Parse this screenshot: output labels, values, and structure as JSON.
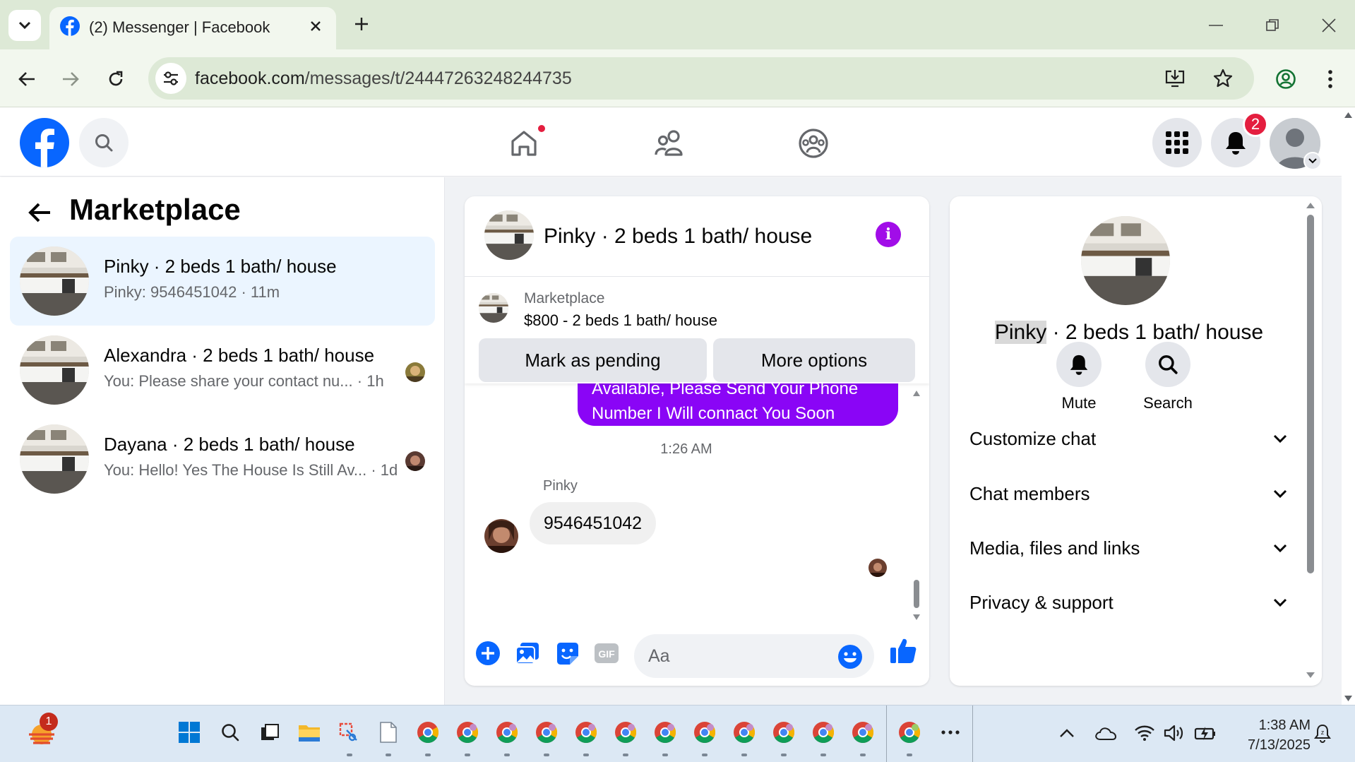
{
  "browser": {
    "tab_title": "(2) Messenger | Facebook",
    "url_host": "facebook.com",
    "url_path": "/messages/t/24447263248244735"
  },
  "fb_header": {
    "notification_count": "2",
    "icons": [
      "facebook-logo",
      "search-icon",
      "home-icon",
      "friends-icon",
      "groups-icon",
      "menu-grid-icon",
      "bell-icon",
      "account-avatar"
    ]
  },
  "sidebar": {
    "title": "Marketplace",
    "conversations": [
      {
        "name": "Pinky · 2 beds 1 bath/ house",
        "preview": "Pinky: 9546451042 · 11m"
      },
      {
        "name": "Alexandra · 2 beds 1 bath/ house",
        "preview": "You: Please share your contact nu...",
        "time": "· 1h"
      },
      {
        "name": "Dayana · 2 beds 1 bath/ house",
        "preview": "You: Hello! Yes The House Is Still Av...",
        "time": "· 1d"
      }
    ]
  },
  "chat": {
    "title": "Pinky · 2 beds 1 bath/ house",
    "marketplace_label": "Marketplace",
    "listing": "$800 - 2 beds 1 bath/ house",
    "mark_pending": "Mark as pending",
    "more_options": "More options",
    "outgoing_line1": "Available, Please Send Your Phone",
    "outgoing_line2": "Number I Will connact You Soon",
    "timestamp": "1:26 AM",
    "sender": "Pinky",
    "incoming": "9546451042",
    "composer_placeholder": "Aa"
  },
  "details": {
    "name_highlight": "Pinky",
    "name_rest": " · 2 beds 1 bath/ house",
    "mute": "Mute",
    "search": "Search",
    "sections": [
      "Customize chat",
      "Chat members",
      "Media, files and links",
      "Privacy & support"
    ]
  },
  "taskbar": {
    "widget_badge": "1",
    "time": "1:38 AM",
    "date": "7/13/2025"
  },
  "colors": {
    "fb_blue": "#0866ff",
    "messenger_purple": "#8a05f6",
    "active_conv": "#ebf5ff",
    "notification_red": "#e41e3f"
  }
}
